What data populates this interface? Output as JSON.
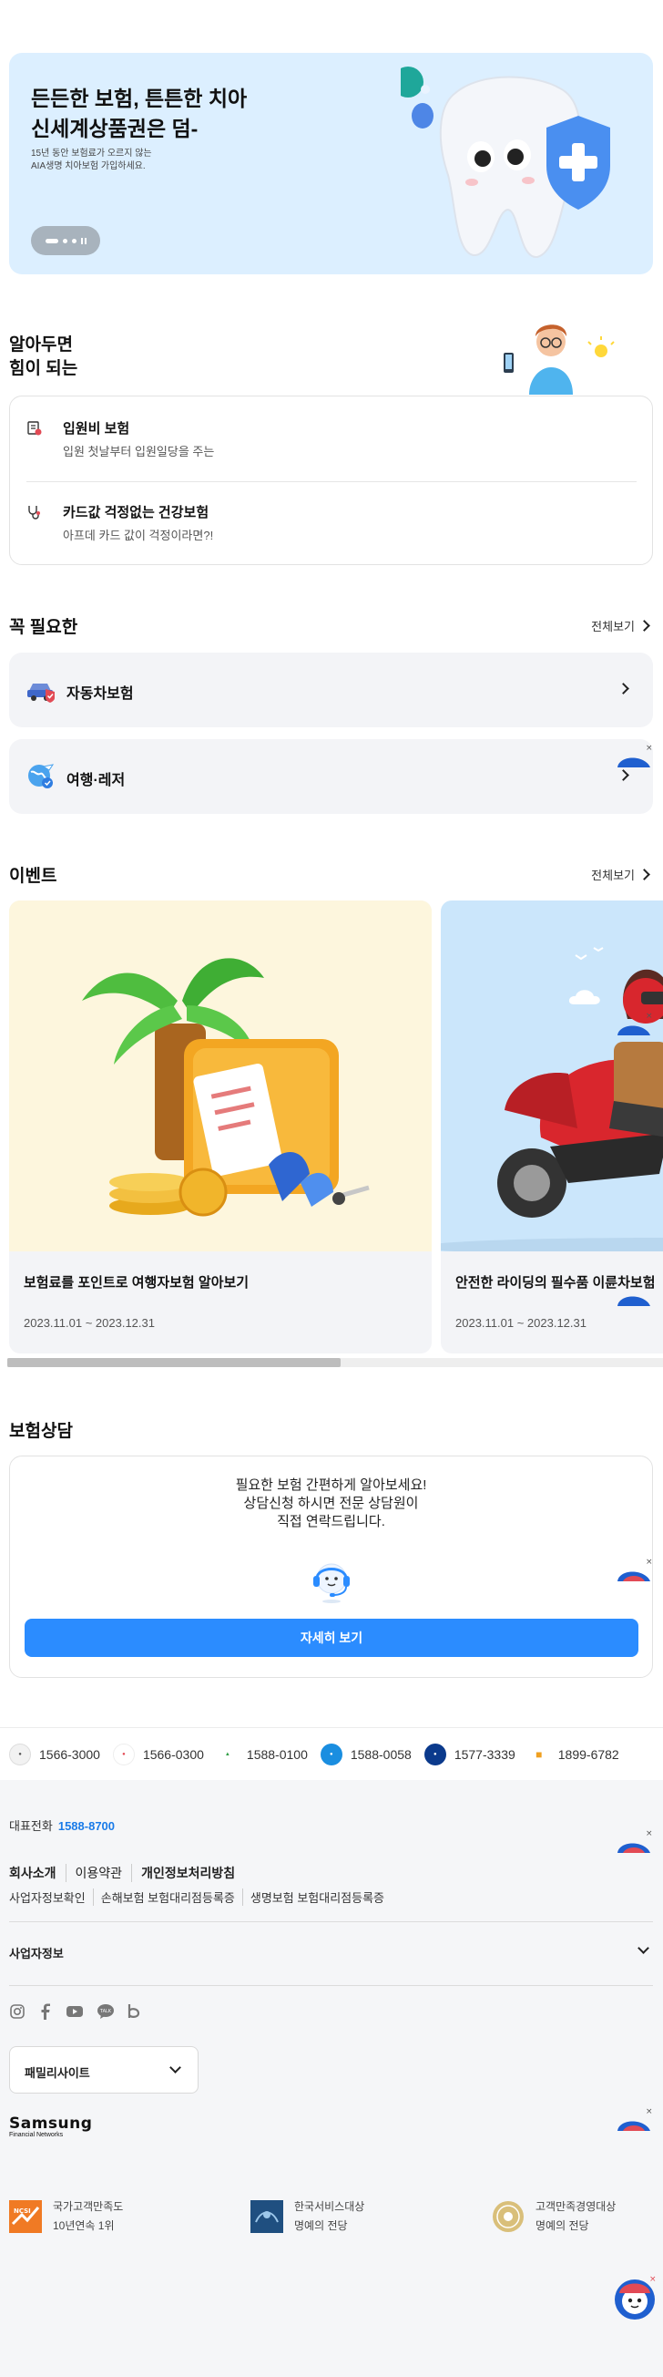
{
  "hero": {
    "title_line1": "든든한 보험, 튼튼한 치아",
    "title_line2": "신세계상품권은 덤-",
    "desc_line1": "15년 동안 보험료가 오르지 않는",
    "desc_line2": "AIA생명 치아보험 가입하세요."
  },
  "know": {
    "title_line1": "알아두면",
    "title_line2": "힘이 되는",
    "items": [
      {
        "title": "입원비 보험",
        "desc": "입원 첫날부터 입원일당을 주는"
      },
      {
        "title": "카드값 걱정없는 건강보험",
        "desc": "아프데 카드 값이 걱정이라면?!"
      }
    ]
  },
  "essential": {
    "title": "꼭 필요한",
    "see_all": "전체보기",
    "items": [
      {
        "label": "자동차보험"
      },
      {
        "label": "여행·레저"
      }
    ]
  },
  "events": {
    "title": "이벤트",
    "see_all": "전체보기",
    "items": [
      {
        "title": "보험료를 포인트로 여행자보험 알아보기",
        "period": "2023.11.01 ~ 2023.12.31"
      },
      {
        "title": "안전한 라이딩의 필수품 이륜차보험",
        "period": "2023.11.01 ~ 2023.12.31"
      }
    ]
  },
  "consult": {
    "title": "보험상담",
    "line1": "필요한 보험 간편하게 알아보세요!",
    "line2": "상담신청 하시면 전문 상담원이",
    "line3": "직접 연락드립니다.",
    "button": "자세히 보기"
  },
  "partners": [
    {
      "number": "1566-3000",
      "color": "#f2f2f2"
    },
    {
      "number": "1566-0300",
      "color": "#f5f5f5"
    },
    {
      "number": "1588-0100",
      "color": "#ffffff"
    },
    {
      "number": "1588-0058",
      "color": "#1a8ee0"
    },
    {
      "number": "1577-3339",
      "color": "#0b3a8c"
    },
    {
      "number": "1899-6782",
      "color": "#ffffff"
    }
  ],
  "footer": {
    "rep_label": "대표전화",
    "rep_number": "1588-8700",
    "links1": [
      "회사소개",
      "이용약관",
      "개인정보처리방침"
    ],
    "links2": [
      "사업자정보확인",
      "손해보험 보험대리점등록증",
      "생명보험 보험대리점등록증"
    ],
    "biz_info": "사업자정보",
    "family_site": "패밀리사이트",
    "brand_main": "Samsung",
    "brand_sub": "Financial Networks",
    "awards": [
      {
        "line1": "국가고객만족도",
        "line2": "10년연속 1위",
        "badge": "NCSI"
      },
      {
        "line1": "한국서비스대상",
        "line2": "명예의 전당",
        "badge": ""
      },
      {
        "line1": "고객만족경영대상",
        "line2": "명예의 전당",
        "badge": ""
      }
    ]
  },
  "colors": {
    "accent": "#2b8cff",
    "link_blue": "#1a7be8",
    "hero_bg": "#dcefff",
    "card_bg": "#f3f4f7"
  },
  "icons": {
    "social": [
      "instagram-icon",
      "facebook-icon",
      "youtube-icon",
      "talk-icon",
      "blog-icon"
    ]
  }
}
